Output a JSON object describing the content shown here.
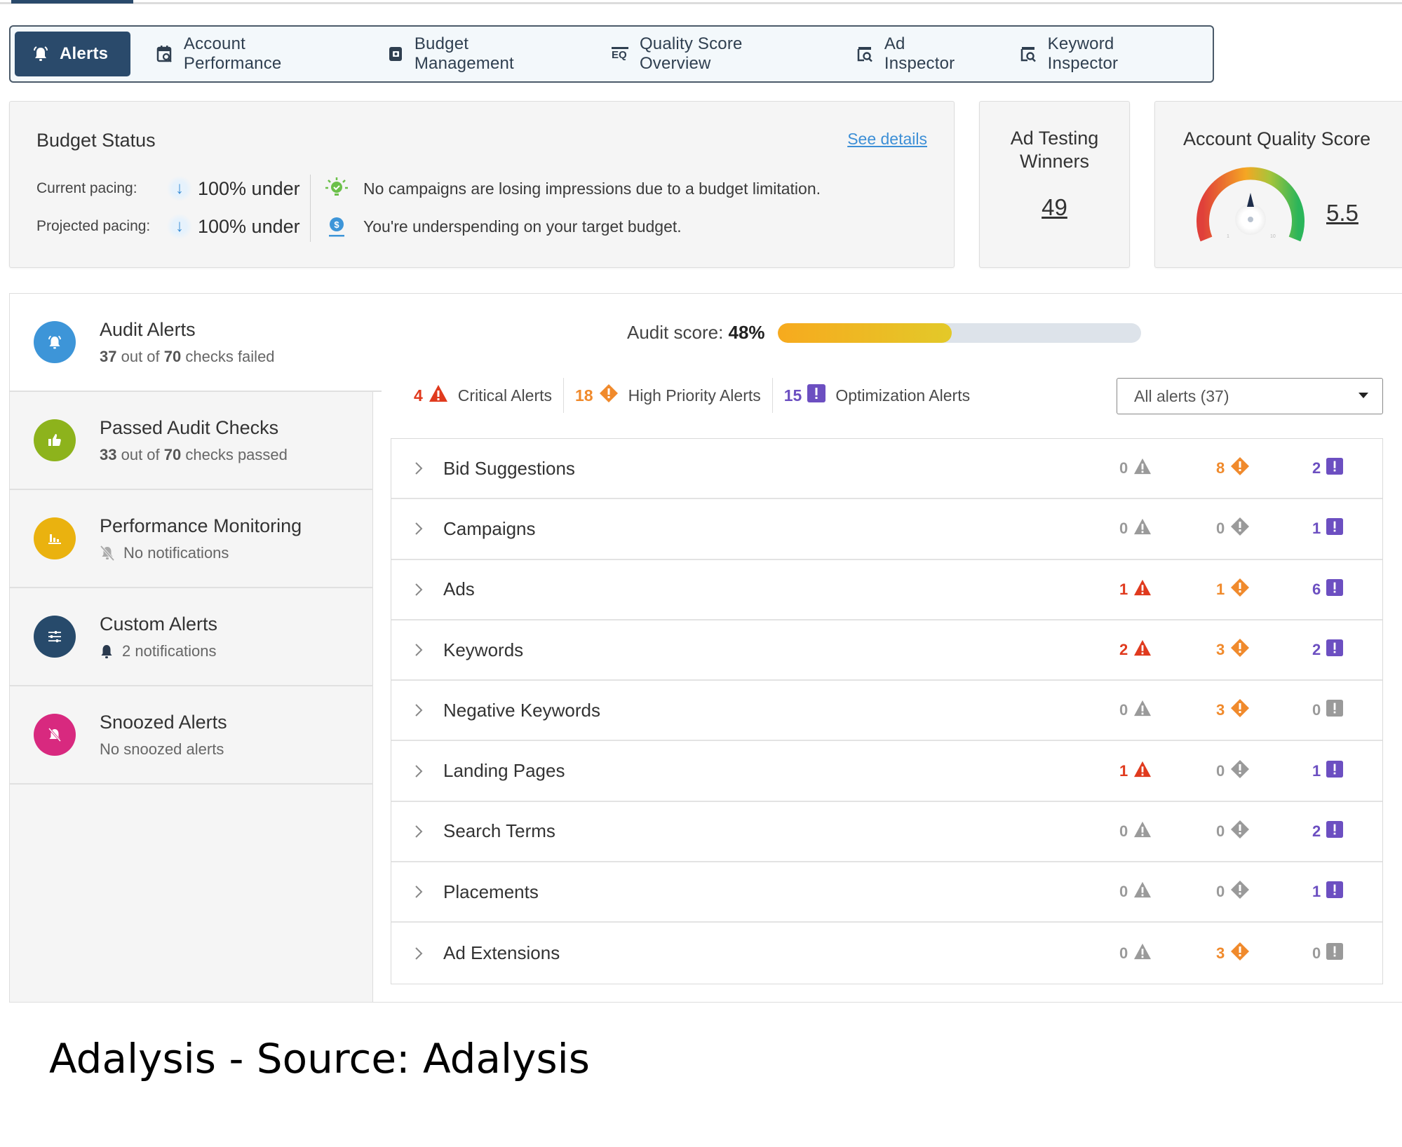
{
  "tabs": [
    {
      "label": "Alerts",
      "icon": "bell-ring-icon",
      "active": true
    },
    {
      "label": "Account Performance",
      "icon": "calendar-search-icon",
      "active": false
    },
    {
      "label": "Budget Management",
      "icon": "wallet-icon",
      "active": false
    },
    {
      "label": "Quality Score Overview",
      "icon": "eq-search-icon",
      "active": false
    },
    {
      "label": "Ad Inspector",
      "icon": "inspect-icon",
      "active": false
    },
    {
      "label": "Keyword Inspector",
      "icon": "inspect-icon",
      "active": false
    }
  ],
  "budget": {
    "title": "Budget Status",
    "see_details": "See details",
    "current_label": "Current pacing:",
    "current_value": "100% under",
    "projected_label": "Projected pacing:",
    "projected_value": "100% under",
    "message_1": "No campaigns are losing impressions due to a budget limitation.",
    "message_2": "You're underspending on your target budget."
  },
  "ad_testing": {
    "title": "Ad Testing Winners",
    "value": "49"
  },
  "quality_score": {
    "title": "Account Quality Score",
    "value": "5.5",
    "score": 5.5,
    "min": 1,
    "max": 10
  },
  "sidebar": [
    {
      "title": "Audit Alerts",
      "sub_a": "37",
      "sub_b": " out of ",
      "sub_c": "70",
      "sub_d": " checks failed",
      "color": "#3d95d8"
    },
    {
      "title": "Passed Audit Checks",
      "sub_a": "33",
      "sub_b": " out of ",
      "sub_c": "70",
      "sub_d": " checks passed",
      "color": "#8db31c"
    },
    {
      "title": "Performance Monitoring",
      "sub": "No notifications",
      "color": "#eab20f"
    },
    {
      "title": "Custom Alerts",
      "sub": "2 notifications",
      "color": "#274a6b"
    },
    {
      "title": "Snoozed Alerts",
      "sub": "No snoozed alerts",
      "color": "#d8297f"
    }
  ],
  "audit_score": {
    "label": "Audit score: ",
    "value": "48%",
    "percent": 48
  },
  "summary": {
    "critical": {
      "count": "4",
      "label": "Critical Alerts"
    },
    "high": {
      "count": "18",
      "label": "High Priority Alerts"
    },
    "optimization": {
      "count": "15",
      "label": "Optimization Alerts"
    }
  },
  "filter": {
    "selected": "All alerts (37)"
  },
  "colors": {
    "critical": "#e03a1e",
    "high": "#f08a2c",
    "optimization": "#6c4fc1",
    "zero": "#9a9a9a"
  },
  "rows": [
    {
      "name": "Bid Suggestions",
      "critical": 0,
      "high": 8,
      "optimization": 2
    },
    {
      "name": "Campaigns",
      "critical": 0,
      "high": 0,
      "optimization": 1
    },
    {
      "name": "Ads",
      "critical": 1,
      "high": 1,
      "optimization": 6
    },
    {
      "name": "Keywords",
      "critical": 2,
      "high": 3,
      "optimization": 2
    },
    {
      "name": "Negative Keywords",
      "critical": 0,
      "high": 3,
      "optimization": 0
    },
    {
      "name": "Landing Pages",
      "critical": 1,
      "high": 0,
      "optimization": 1
    },
    {
      "name": "Search Terms",
      "critical": 0,
      "high": 0,
      "optimization": 2
    },
    {
      "name": "Placements",
      "critical": 0,
      "high": 0,
      "optimization": 1
    },
    {
      "name": "Ad Extensions",
      "critical": 0,
      "high": 3,
      "optimization": 0
    }
  ],
  "caption": "Adalysis - Source: Adalysis"
}
